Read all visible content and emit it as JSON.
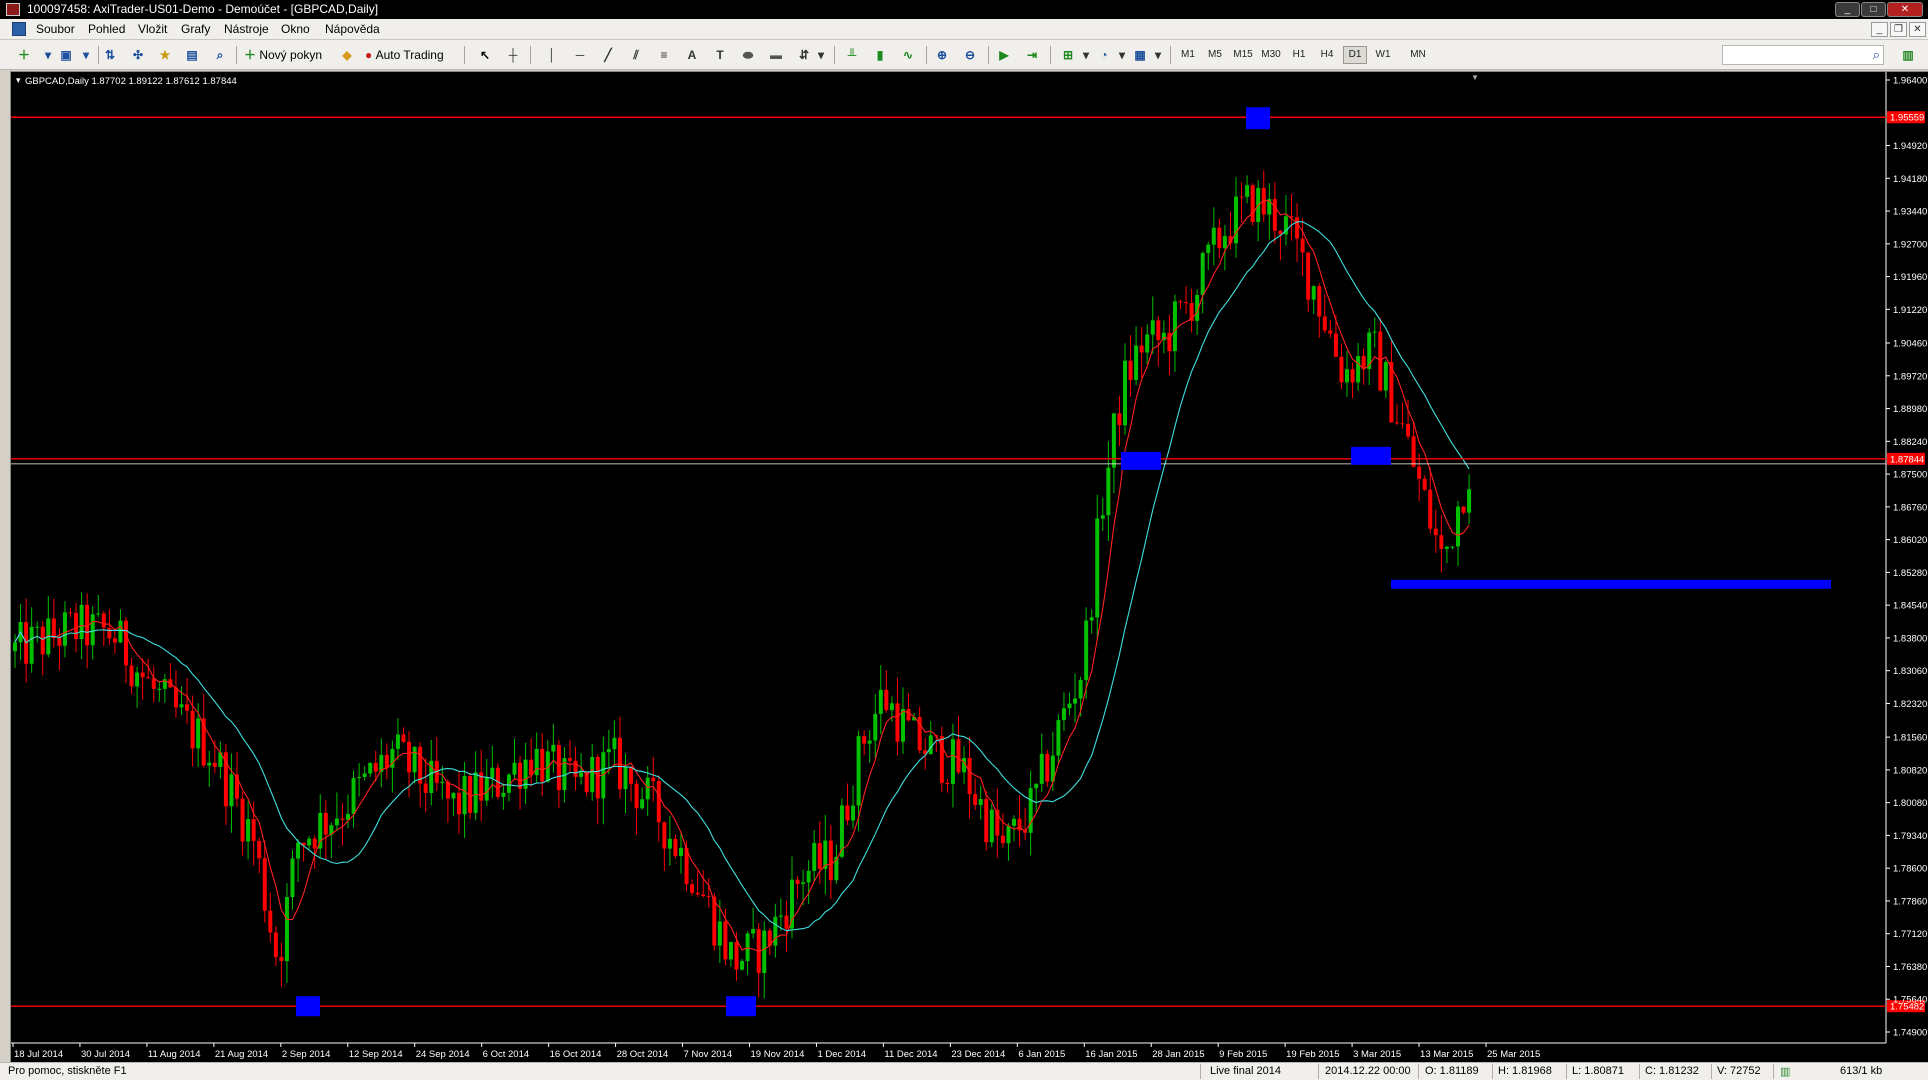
{
  "window": {
    "title": "100097458: AxiTrader-US01-Demo - Demoúčet - [GBPCAD,Daily]"
  },
  "menu": {
    "items": [
      "Soubor",
      "Pohled",
      "Vložit",
      "Grafy",
      "Nástroje",
      "Okno",
      "Nápověda"
    ]
  },
  "toolbar": {
    "new_order_label": "Nový pokyn",
    "auto_trading_label": "Auto Trading",
    "timeframes": [
      "M1",
      "M5",
      "M15",
      "M30",
      "H1",
      "H4",
      "D1",
      "W1",
      "MN"
    ],
    "active_timeframe": "D1",
    "search_placeholder": ""
  },
  "chart": {
    "header": "GBPCAD,Daily  1.87702 1.89122 1.87612 1.87844",
    "colors": {
      "background": "#000000",
      "bull": "#00c000",
      "bear": "#ff0000",
      "ma_fast": "#ff2020",
      "ma_slow": "#40e0e0",
      "levels": "#ff0000",
      "zones": "#0000ff",
      "axis_text": "#ffffff"
    },
    "price_labels": [
      "1.96400",
      "1.94920",
      "1.94180",
      "1.93440",
      "1.92700",
      "1.91960",
      "1.91220",
      "1.90460",
      "1.89720",
      "1.88980",
      "1.88240",
      "1.87500",
      "1.86760",
      "1.86020",
      "1.85280",
      "1.84540",
      "1.83800",
      "1.83060",
      "1.82320",
      "1.81560",
      "1.80820",
      "1.80080",
      "1.79340",
      "1.78600",
      "1.77860",
      "1.77120",
      "1.76380",
      "1.75640",
      "1.74900"
    ],
    "level_labels": [
      "1.95559",
      "1.87844",
      "1.75482"
    ],
    "date_labels": [
      "18 Jul 2014",
      "30 Jul 2014",
      "11 Aug 2014",
      "21 Aug 2014",
      "2 Sep 2014",
      "12 Sep 2014",
      "24 Sep 2014",
      "6 Oct 2014",
      "16 Oct 2014",
      "28 Oct 2014",
      "7 Nov 2014",
      "19 Nov 2014",
      "1 Dec 2014",
      "11 Dec 2014",
      "23 Dec 2014",
      "6 Jan 2015",
      "16 Jan 2015",
      "28 Jan 2015",
      "9 Feb 2015",
      "19 Feb 2015",
      "3 Mar 2015",
      "13 Mar 2015",
      "25 Mar 2015"
    ]
  },
  "status": {
    "help": "Pro pomoc, stiskněte F1",
    "profile": "Live final 2014",
    "datetime": "2014.12.22 00:00",
    "open": "O: 1.81189",
    "high": "H: 1.81968",
    "low": "L: 1.80871",
    "close": "C: 1.81232",
    "volume": "V: 72752",
    "traffic": "613/1 kb"
  }
}
